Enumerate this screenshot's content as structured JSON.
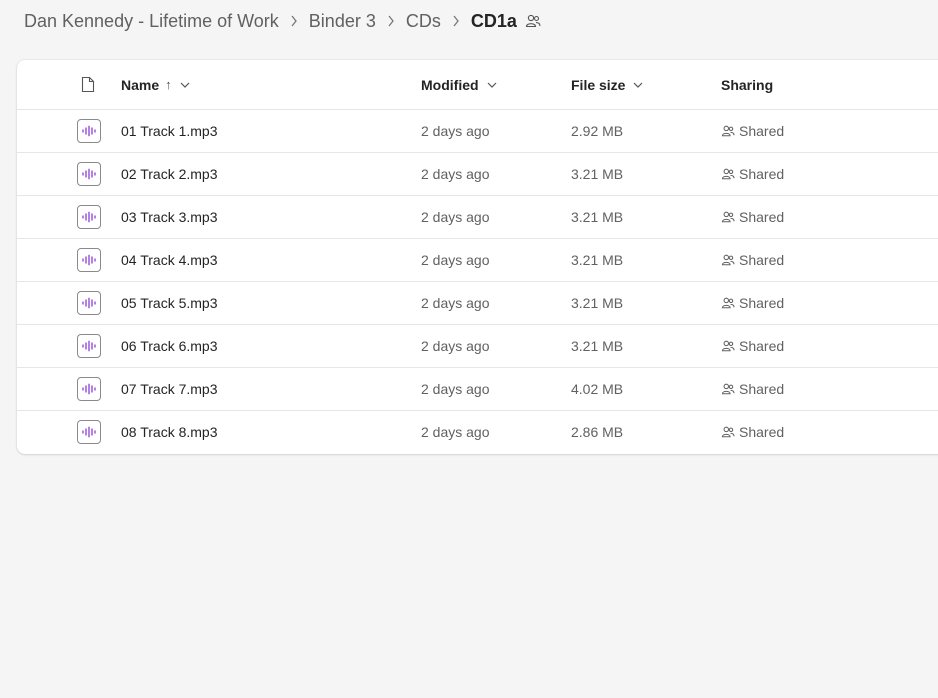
{
  "breadcrumb": {
    "items": [
      "Dan Kennedy - Lifetime of Work",
      "Binder 3",
      "CDs"
    ],
    "current": "CD1a",
    "separator": ">"
  },
  "table": {
    "columns": {
      "name": "Name",
      "name_sort_arrow": "↑",
      "modified": "Modified",
      "file_size": "File size",
      "sharing": "Sharing"
    },
    "rows": [
      {
        "name": "01 Track 1.mp3",
        "modified": "2 days ago",
        "size": "2.92 MB",
        "sharing": "Shared"
      },
      {
        "name": "02 Track 2.mp3",
        "modified": "2 days ago",
        "size": "3.21 MB",
        "sharing": "Shared"
      },
      {
        "name": "03 Track 3.mp3",
        "modified": "2 days ago",
        "size": "3.21 MB",
        "sharing": "Shared"
      },
      {
        "name": "04 Track 4.mp3",
        "modified": "2 days ago",
        "size": "3.21 MB",
        "sharing": "Shared"
      },
      {
        "name": "05 Track 5.mp3",
        "modified": "2 days ago",
        "size": "3.21 MB",
        "sharing": "Shared"
      },
      {
        "name": "06 Track 6.mp3",
        "modified": "2 days ago",
        "size": "3.21 MB",
        "sharing": "Shared"
      },
      {
        "name": "07 Track 7.mp3",
        "modified": "2 days ago",
        "size": "4.02 MB",
        "sharing": "Shared"
      },
      {
        "name": "08 Track 8.mp3",
        "modified": "2 days ago",
        "size": "2.86 MB",
        "sharing": "Shared"
      }
    ]
  },
  "icons": {
    "file_type": "audio-file-icon",
    "shared": "people-icon",
    "header_doc": "document-icon"
  },
  "colors": {
    "audio_accent": "#8b3ed6",
    "background": "#f5f5f5",
    "panel": "#ffffff"
  }
}
